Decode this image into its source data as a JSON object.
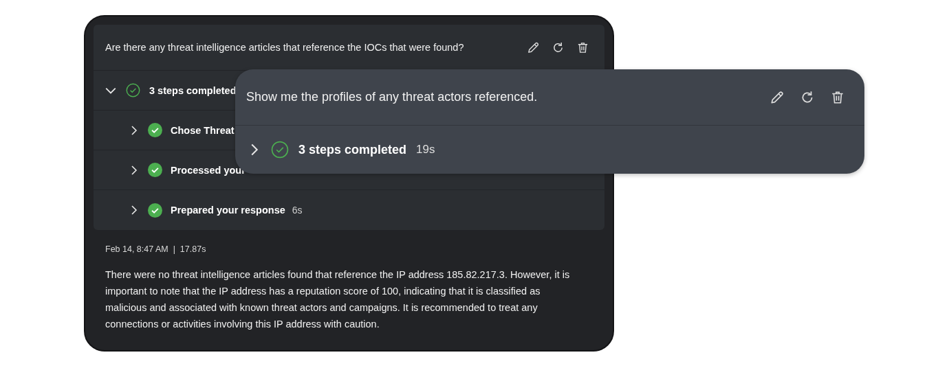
{
  "conversation": {
    "question": "Are there any threat intelligence articles that reference the IOCs that were found?",
    "summary": {
      "label": "3 steps completed",
      "expanded": true
    },
    "steps": [
      {
        "label": "Chose Threat"
      },
      {
        "label": "Processed your"
      },
      {
        "label": "Prepared your response",
        "duration": "6s"
      }
    ],
    "response": {
      "meta": "Feb 14, 8:47 AM  |  17.87s",
      "text": "There were no threat intelligence articles found that reference the IP address 185.82.217.3. However, it is important to note that the IP address has a reputation score of 100, indicating that it is classified as malicious and associated with known threat actors and campaigns. It is recommended to treat any connections or activities involving this IP address with caution."
    }
  },
  "popout": {
    "question": "Show me the profiles of any threat actors referenced.",
    "summary": {
      "label": "3 steps completed",
      "duration": "19s",
      "expanded": false
    }
  }
}
